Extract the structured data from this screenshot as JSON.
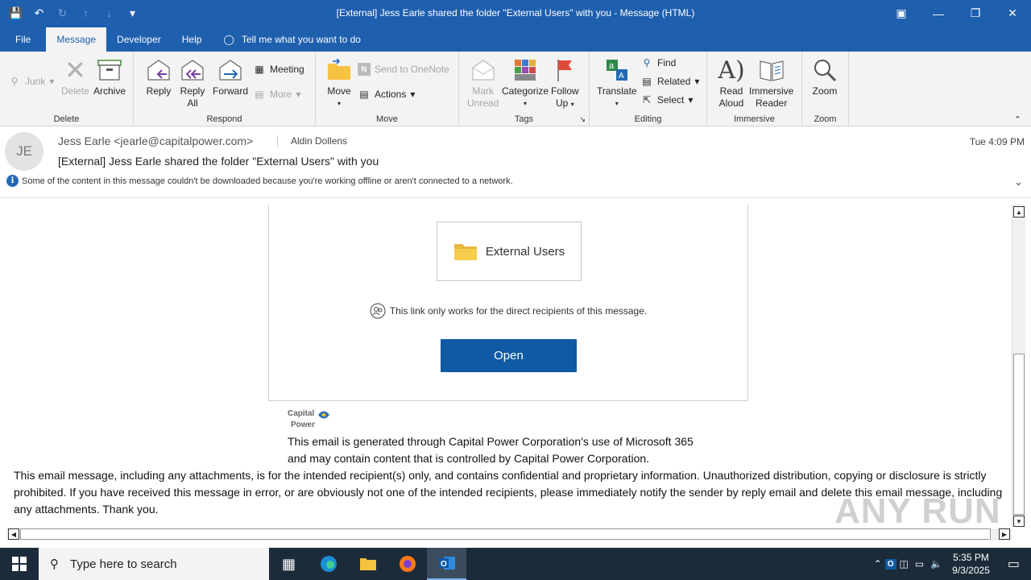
{
  "window": {
    "title": "[External] Jess Earle shared the folder \"External Users\" with you  -  Message (HTML)"
  },
  "tabs": [
    "File",
    "Message",
    "Developer",
    "Help"
  ],
  "tell_me": "Tell me what you want to do",
  "ribbon": {
    "delete_group": {
      "name": "Delete",
      "junk": "Junk",
      "delete": "Delete",
      "archive": "Archive"
    },
    "respond_group": {
      "name": "Respond",
      "reply": "Reply",
      "reply_all_1": "Reply",
      "reply_all_2": "All",
      "forward": "Forward",
      "meeting": "Meeting",
      "more": "More"
    },
    "move_group": {
      "name": "Move",
      "move": "Move",
      "onenote": "Send to OneNote",
      "actions": "Actions"
    },
    "tags_group": {
      "name": "Tags",
      "mark_unread_1": "Mark",
      "mark_unread_2": "Unread",
      "categorize": "Categorize",
      "follow_up_1": "Follow",
      "follow_up_2": "Up"
    },
    "editing_group": {
      "name": "Editing",
      "translate": "Translate",
      "find": "Find",
      "related": "Related",
      "select": "Select"
    },
    "immersive_group": {
      "name": "Immersive",
      "read_aloud_1": "Read",
      "read_aloud_2": "Aloud",
      "immersive_reader_1": "Immersive",
      "immersive_reader_2": "Reader"
    },
    "zoom_group": {
      "name": "Zoom",
      "zoom": "Zoom"
    }
  },
  "message": {
    "avatar_initials": "JE",
    "from": "Jess Earle <jearle@capitalpower.com>",
    "to": "Aldin Dollens",
    "subject": "[External] Jess Earle shared the folder \"External Users\" with you",
    "date": "Tue 4:09 PM",
    "info_bar": "Some of the content in this message couldn't be downloaded because you're working offline or aren't connected to a network."
  },
  "body": {
    "folder_name": "External Users",
    "link_note": "This link only works for the direct recipients of this message.",
    "open_button": "Open",
    "logo_line1": "Capital",
    "logo_line2": "Power",
    "generated_1": "This email is generated through Capital Power Corporation's use of Microsoft 365",
    "generated_2": "and may contain content that is controlled by Capital Power Corporation.",
    "disclaimer": "This email message, including any attachments, is for the intended recipient(s) only, and contains confidential and proprietary information. Unauthorized distribution, copying or disclosure is strictly prohibited. If you have received this message in error, or are obviously not one of the intended recipients, please immediately notify the sender by reply email and delete this email message, including any attachments. Thank you."
  },
  "watermark": "ANY RUN",
  "taskbar": {
    "search_placeholder": "Type here to search",
    "time": "5:35 PM",
    "date": "9/3/2025"
  },
  "colors": {
    "titlebar": "#1e5fae",
    "open_button": "#0f5aa3",
    "taskbar": "#1c2b3a"
  }
}
